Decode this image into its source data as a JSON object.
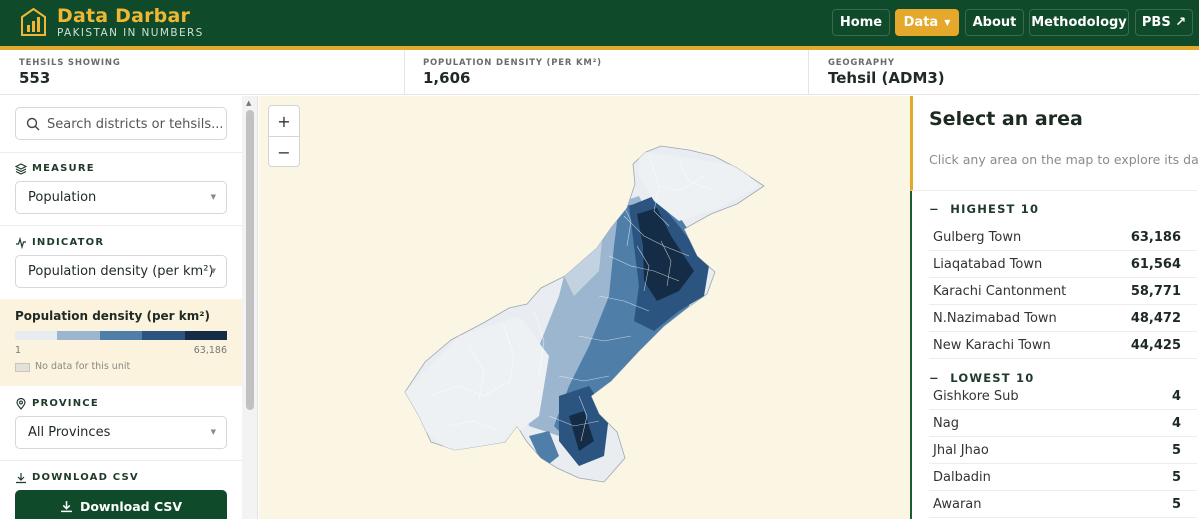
{
  "header": {
    "brand_title": "Data Darbar",
    "brand_subtitle": "PAKISTAN IN NUMBERS",
    "nav": [
      {
        "label": "Home"
      },
      {
        "label": "Data",
        "active": true
      },
      {
        "label": "About"
      },
      {
        "label": "Methodology"
      },
      {
        "label": "PBS ↗"
      }
    ],
    "brand_color": "#0f4a2a",
    "accent_color": "#e5a82a"
  },
  "stats": [
    {
      "label": "TEHSILS SHOWING",
      "value": "553"
    },
    {
      "label": "POPULATION DENSITY (PER KM²)",
      "value": "1,606"
    },
    {
      "label": "GEOGRAPHY",
      "value": "Tehsil (ADM3)"
    }
  ],
  "sidebar": {
    "search_placeholder": "Search districts or tehsils...",
    "measure_label": "MEASURE",
    "measure_value": "Population",
    "indicator_label": "INDICATOR",
    "indicator_value": "Population density (per km²)",
    "legend": {
      "title": "Population density (per km²)",
      "min": "1",
      "max": "63,186",
      "nodata": "No data for this unit",
      "colors": [
        "#e7ecf1",
        "#9cb6cf",
        "#4f7ea9",
        "#2b5580",
        "#142c45"
      ]
    },
    "province_label": "PROVINCE",
    "province_value": "All Provinces",
    "download_label": "DOWNLOAD CSV",
    "download_button": "Download CSV"
  },
  "map": {
    "zoom_in": "+",
    "zoom_out": "−"
  },
  "panel": {
    "title": "Select an area",
    "hint": "Click any area on the map to explore its data.",
    "highest_label": "HIGHEST 10",
    "highest": [
      {
        "name": "Gulberg Town",
        "value": "63,186"
      },
      {
        "name": "Liaqatabad Town",
        "value": "61,564"
      },
      {
        "name": "Karachi Cantonment",
        "value": "58,771"
      },
      {
        "name": "N.Nazimabad Town",
        "value": "48,472"
      },
      {
        "name": "New Karachi Town",
        "value": "44,425"
      }
    ],
    "lowest_label": "LOWEST 10",
    "lowest": [
      {
        "name": "Gishkore Sub",
        "value": "4"
      },
      {
        "name": "Nag",
        "value": "4"
      },
      {
        "name": "Jhal Jhao",
        "value": "5"
      },
      {
        "name": "Dalbadin",
        "value": "5"
      },
      {
        "name": "Awaran",
        "value": "5"
      }
    ]
  }
}
